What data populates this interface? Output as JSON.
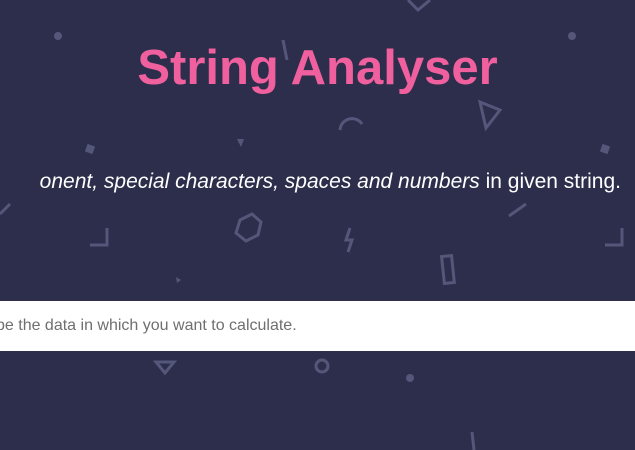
{
  "title": "String Analyser",
  "description": {
    "part1_italic": "onent, special characters, spaces and numbers",
    "part2": " in given string."
  },
  "input": {
    "placeholder": "ype the data in which you want to calculate.",
    "value": ""
  },
  "colors": {
    "background": "#2d2e4c",
    "title": "#f0609e",
    "shape": "#55577a"
  },
  "background_shape_icons": [
    "dot-icon",
    "triangle-icon",
    "arc-icon",
    "hexagon-icon",
    "lightning-icon",
    "rectangle-icon",
    "ring-icon",
    "corner-icon",
    "dash-icon",
    "square-icon"
  ]
}
